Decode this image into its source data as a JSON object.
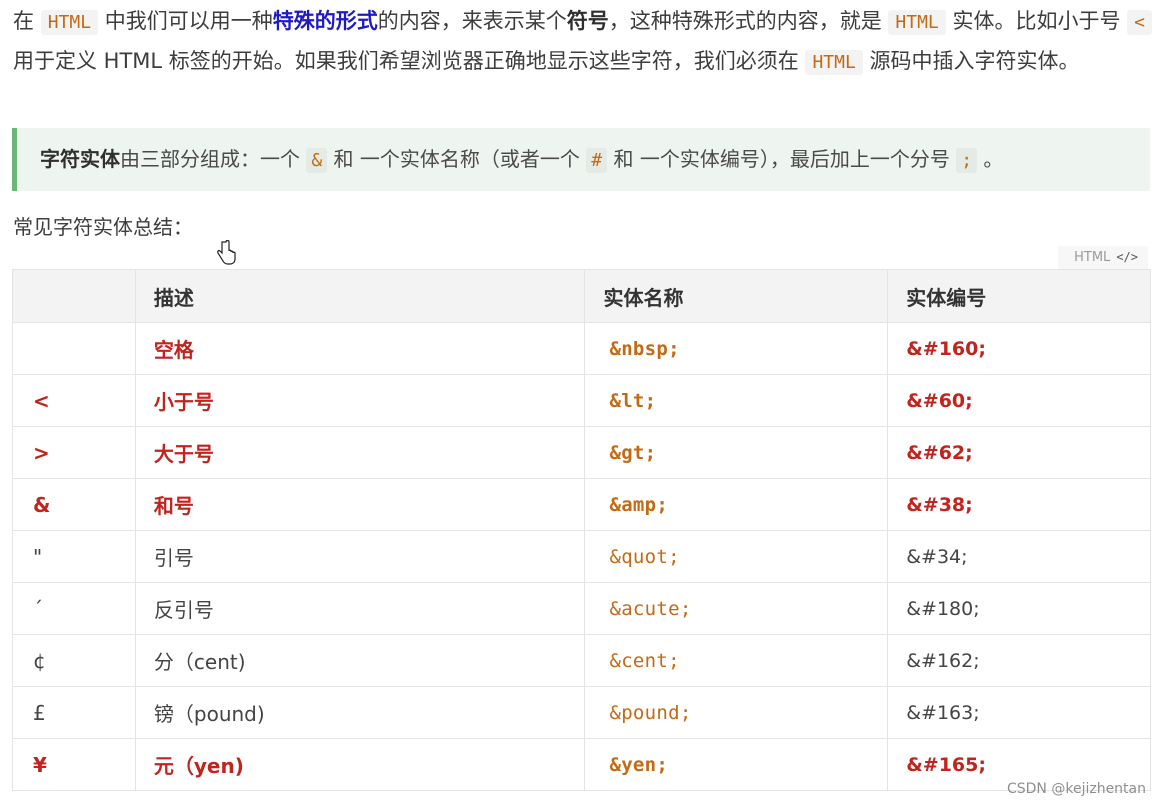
{
  "intro": {
    "p1": "在 ",
    "code1": "HTML",
    "p2": " 中我们可以用一种",
    "highlight": "特殊的形式",
    "p3": "的内容，来表示某个",
    "bold1": "符号",
    "p4": "，这种特殊形式的内容，就是 ",
    "code2": "HTML",
    "p5": " 实体。比如小于号 ",
    "code3": "<",
    "p6": " 用于定义 HTML 标签的开始。如果我们希望浏览器正确地显示这些字符，我们必须在 ",
    "code4": "HTML",
    "p7": " 源码中插入字符实体。"
  },
  "note": {
    "bold": "字符实体",
    "t1": "由三部分组成：一个 ",
    "code1": "&",
    "t2": " 和 一个实体名称（或者一个 ",
    "code2": "#",
    "t3": " 和 一个实体编号），最后加上一个分号 ",
    "code3": ";",
    "t4": " 。"
  },
  "summary_label": "常见字符实体总结：",
  "code_lang": "HTML",
  "code_icon": "code-icon",
  "table": {
    "headers": [
      "",
      "描述",
      "实体名称",
      "实体编号"
    ],
    "rows": [
      {
        "sym": "",
        "desc": "空格",
        "name": "&nbsp;",
        "num": "&#160;",
        "emphasis": true
      },
      {
        "sym": "<",
        "desc": "小于号",
        "name": "&lt;",
        "num": "&#60;",
        "emphasis": true
      },
      {
        "sym": ">",
        "desc": "大于号",
        "name": "&gt;",
        "num": "&#62;",
        "emphasis": true
      },
      {
        "sym": "&",
        "desc": "和号",
        "name": "&amp;",
        "num": "&#38;",
        "emphasis": true
      },
      {
        "sym": "\"",
        "desc": "引号",
        "name": "&quot;",
        "num": "&#34;",
        "emphasis": false
      },
      {
        "sym": "´",
        "desc": "反引号",
        "name": "&acute;",
        "num": "&#180;",
        "emphasis": false
      },
      {
        "sym": "¢",
        "desc": "分（cent)",
        "name": "&cent;",
        "num": "&#162;",
        "emphasis": false
      },
      {
        "sym": "£",
        "desc": "镑（pound)",
        "name": "&pound;",
        "num": "&#163;",
        "emphasis": false
      },
      {
        "sym": "¥",
        "desc": "元（yen)",
        "name": "&yen;",
        "num": "&#165;",
        "emphasis": true
      }
    ]
  },
  "watermark": "CSDN @kejizhentan",
  "colors": {
    "accent_code": "#c46a14",
    "emphasis_red": "#c0241d",
    "highlight_blue": "#1f1bc4",
    "note_border": "#6ab77a",
    "note_bg": "#eef4ef"
  }
}
